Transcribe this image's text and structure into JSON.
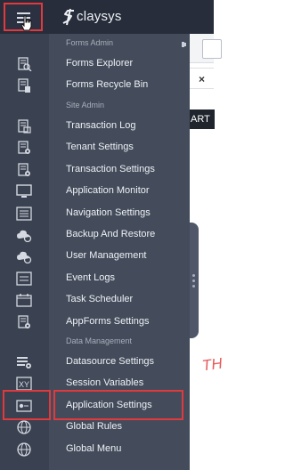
{
  "header": {
    "menu_icon": "hamburger-menu-icon",
    "logo_text": "claysys",
    "logo_icon": "claysys-s-logo-icon"
  },
  "background": {
    "close_glyph": "×",
    "toolbar_fragment": "ART",
    "watermark_fragment": "TH"
  },
  "sidebar": {
    "sections": [
      {
        "title": "Forms Admin",
        "items": [
          {
            "label": "Forms Explorer",
            "icon": "forms-explorer-icon"
          },
          {
            "label": "Forms Recycle Bin",
            "icon": "recycle-bin-icon"
          }
        ]
      },
      {
        "title": "Site Admin",
        "items": [
          {
            "label": "Transaction Log",
            "icon": "transaction-log-icon"
          },
          {
            "label": "Tenant Settings",
            "icon": "tenant-settings-icon"
          },
          {
            "label": "Transaction Settings",
            "icon": "transaction-settings-icon"
          },
          {
            "label": "Application Monitor",
            "icon": "monitor-icon"
          },
          {
            "label": "Navigation Settings",
            "icon": "navigation-settings-icon"
          },
          {
            "label": "Backup And Restore",
            "icon": "cloud-backup-icon"
          },
          {
            "label": "User Management",
            "icon": "cloud-user-icon"
          },
          {
            "label": "Event Logs",
            "icon": "event-logs-icon"
          },
          {
            "label": "Task Scheduler",
            "icon": "calendar-icon"
          },
          {
            "label": "AppForms Settings",
            "icon": "appforms-settings-icon"
          }
        ]
      },
      {
        "title": "Data Management",
        "items": [
          {
            "label": "Datasource Settings",
            "icon": "datasource-settings-icon"
          },
          {
            "label": "Session Variables",
            "icon": "session-variables-icon"
          },
          {
            "label": "Application Settings",
            "icon": "application-settings-icon"
          },
          {
            "label": "Global Rules",
            "icon": "globe-rules-icon"
          },
          {
            "label": "Global Menu",
            "icon": "globe-menu-icon"
          }
        ]
      }
    ]
  },
  "colors": {
    "topbar": "#272d3a",
    "sidebar": "#444c5b",
    "rail": "#3a4150",
    "highlight": "#e0393e",
    "text": "#eef1f6",
    "section_text": "#a7aebb"
  }
}
